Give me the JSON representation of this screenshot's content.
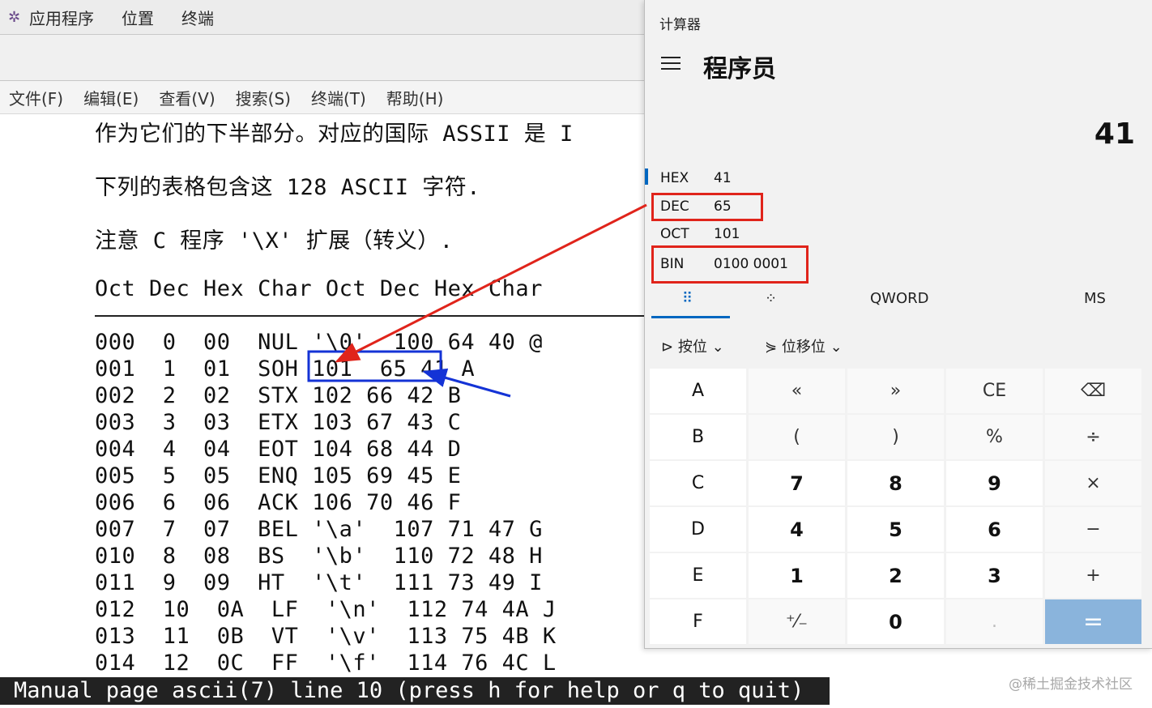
{
  "topbar": {
    "items": [
      "应用程序",
      "位置",
      "终端"
    ]
  },
  "terminal": {
    "menu": [
      "文件(F)",
      "编辑(E)",
      "查看(V)",
      "搜索(S)",
      "终端(T)",
      "帮助(H)"
    ],
    "text_lines": [
      "作为它们的下半部分。对应的国际 ASSII 是 I",
      "下列的表格包含这 128 ASCII 字符.",
      "注意 C 程序 '\\X' 扩展（转义）."
    ],
    "table_header": "Oct Dec Hex Char Oct Dec Hex Char",
    "rows": [
      "000  0  00  NUL '\\0'  100 64 40 @",
      "001  1  01  SOH 101  65 41 A",
      "002  2  02  STX 102 66 42 B",
      "003  3  03  ETX 103 67 43 C",
      "004  4  04  EOT 104 68 44 D",
      "005  5  05  ENQ 105 69 45 E",
      "006  6  06  ACK 106 70 46 F",
      "007  7  07  BEL '\\a'  107 71 47 G",
      "010  8  08  BS  '\\b'  110 72 48 H",
      "011  9  09  HT  '\\t'  111 73 49 I",
      "012  10  0A  LF  '\\n'  112 74 4A J",
      "013  11  0B  VT  '\\v'  113 75 4B K",
      "014  12  0C  FF  '\\f'  114 76 4C L"
    ],
    "status": "Manual page ascii(7) line 10 (press h for help or q to quit)"
  },
  "watermark": "@稀土掘金技术社区",
  "calculator": {
    "window_title": "计算器",
    "mode": "程序员",
    "display": "41",
    "radix": [
      {
        "label": "HEX",
        "value": "41"
      },
      {
        "label": "DEC",
        "value": "65"
      },
      {
        "label": "OCT",
        "value": "101"
      },
      {
        "label": "BIN",
        "value": "0100 0001"
      }
    ],
    "tabs": {
      "keypad_icon": "⠿",
      "bits_icon": "⁘",
      "word_size": "QWORD",
      "memory": "MS"
    },
    "bitwise": {
      "label": "按位",
      "shift_label": "位移位"
    },
    "keys": [
      [
        "A",
        "«",
        "»",
        "CE",
        "⌫"
      ],
      [
        "B",
        "(",
        ")",
        "%",
        "÷"
      ],
      [
        "C",
        "7",
        "8",
        "9",
        "×"
      ],
      [
        "D",
        "4",
        "5",
        "6",
        "−"
      ],
      [
        "E",
        "1",
        "2",
        "3",
        "+"
      ],
      [
        "F",
        "⁺⁄₋",
        "0",
        ".",
        "="
      ]
    ]
  },
  "colors": {
    "annotation_red": "#e0241b",
    "annotation_blue": "#1433d6",
    "accent": "#0067c0",
    "equals_key": "#8ab4dc"
  }
}
